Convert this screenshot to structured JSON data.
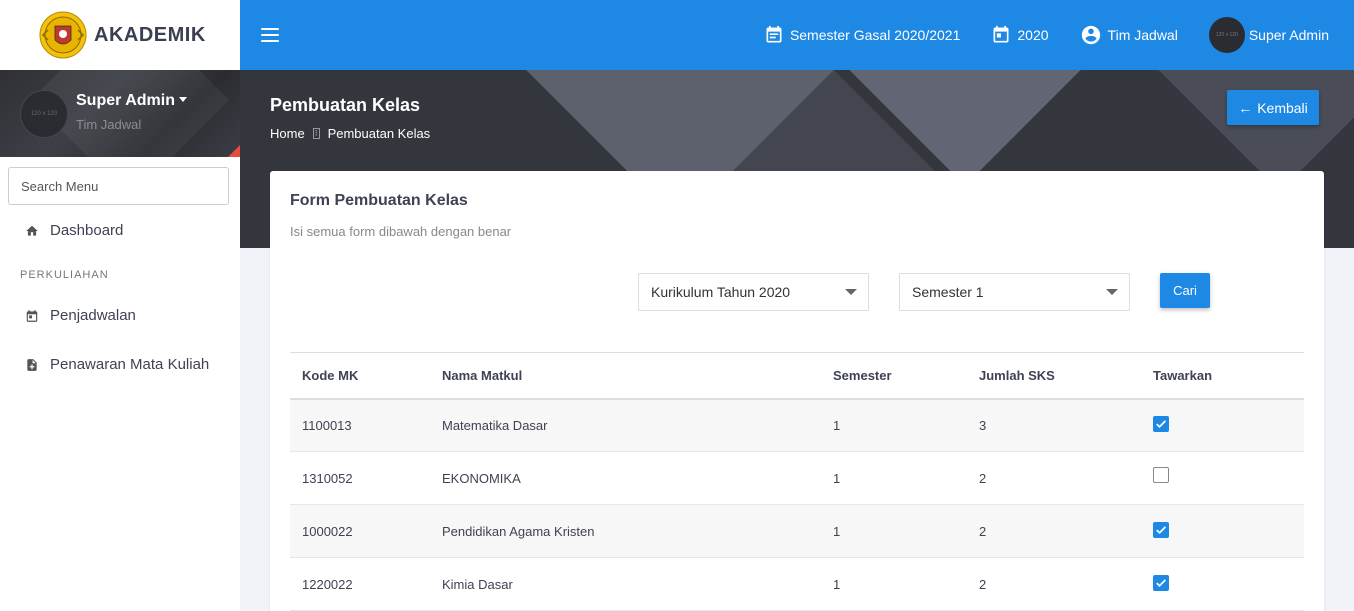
{
  "brand": {
    "title": "AKADEMIK"
  },
  "user": {
    "name": "Super Admin",
    "role": "Tim Jadwal",
    "avatar_text": "120 x 120"
  },
  "sidebar": {
    "search_placeholder": "Search Menu",
    "dashboard_label": "Dashboard",
    "section_header": "PERKULIAHAN",
    "items": [
      {
        "label": "Penjadwalan",
        "icon": "calendar-icon"
      },
      {
        "label": "Penawaran Mata Kuliah",
        "icon": "document-icon"
      }
    ]
  },
  "topbar": {
    "semester": "Semester Gasal 2020/2021",
    "year": "2020",
    "team": "Tim Jadwal",
    "user": "Super Admin",
    "avatar_text": "120 x 120"
  },
  "header": {
    "title": "Pembuatan Kelas",
    "breadcrumb": [
      "Home",
      "Pembuatan Kelas"
    ],
    "back_label": "Kembali"
  },
  "form": {
    "title": "Form Pembuatan Kelas",
    "subtitle": "Isi semua form dibawah dengan benar",
    "curriculum_select": "Kurikulum Tahun 2020",
    "semester_select": "Semester 1",
    "search_label": "Cari"
  },
  "table": {
    "headers": [
      "Kode MK",
      "Nama Matkul",
      "Semester",
      "Jumlah SKS",
      "Tawarkan"
    ],
    "rows": [
      {
        "kode": "1100013",
        "nama": "Matematika Dasar",
        "semester": "1",
        "sks": "3",
        "tawarkan": true
      },
      {
        "kode": "1310052",
        "nama": "EKONOMIKA",
        "semester": "1",
        "sks": "2",
        "tawarkan": false
      },
      {
        "kode": "1000022",
        "nama": "Pendidikan Agama Kristen",
        "semester": "1",
        "sks": "2",
        "tawarkan": true
      },
      {
        "kode": "1220022",
        "nama": "Kimia Dasar",
        "semester": "1",
        "sks": "2",
        "tawarkan": true
      }
    ]
  },
  "colors": {
    "primary": "#1e88e5",
    "dark": "#34363d"
  }
}
